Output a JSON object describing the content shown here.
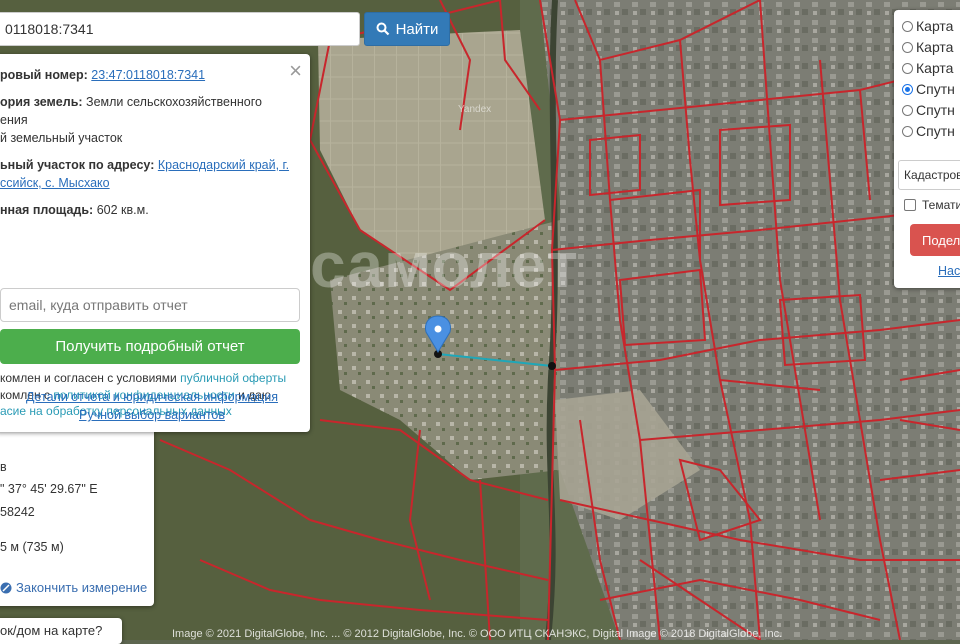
{
  "search": {
    "value": "0118018:7341",
    "button_label": "Найти"
  },
  "info": {
    "cadastral_label": "ровый номер:",
    "cadastral_number": "23:47:0118018:7341",
    "category_label": "ория земель:",
    "category_value": "Земли сельскохозяйственного",
    "category_value_cont": "ения",
    "type_value": "й земельный участок",
    "address_label": "ьный участок по адресу:",
    "address_value_line1": "Краснодарский край, г.",
    "address_value_line2": "ссийск, с. Мысхако",
    "area_label": "нная площадь:",
    "area_value": "602 кв.м.",
    "email_placeholder": "email, куда отправить отчет",
    "report_button": "Получить подробный отчет",
    "agree1_pre": "комлен и согласен с условиями ",
    "agree1_link": "публичной оферты",
    "agree2_pre": "комлен с ",
    "agree2_link": "политикой конфиденциальности",
    "agree2_post": " и даю",
    "agree3_link": "асие на обработку персональных данных",
    "details_link": "Детали отчета и юридическая информация",
    "manual_link": "Ручной выбор вариантов"
  },
  "measure": {
    "partial_header": "...",
    "line1": "в",
    "line2": "\" 37° 45' 29.67\" E",
    "line3": "58242",
    "line4": "5 м (735 м)",
    "finish_label": "Закончить измерение"
  },
  "bottom_question": "ок/дом на карте?",
  "layers": {
    "options": [
      {
        "label": "Карта",
        "selected": false
      },
      {
        "label": "Карта",
        "selected": false
      },
      {
        "label": "Карта",
        "selected": false
      },
      {
        "label": "Спутн",
        "selected": true
      },
      {
        "label": "Спутн",
        "selected": false
      },
      {
        "label": "Спутн",
        "selected": false
      }
    ],
    "select_value": "Кадастров",
    "checkbox_label": "Темати",
    "share_button": "Подел",
    "settings_link": "Нас"
  },
  "watermark": "самолет",
  "map_label": "Yandex",
  "copyright": "Image © 2021 DigitalGlobe, Inc. ... © 2012 DigitalGlobe, Inc. © ООО ИТЦ СКАНЭКС, Digital Image © 2018 DigitalGlobe, Inc.",
  "colors": {
    "parcel_lines": "#c8262c",
    "accent": "#337ab7",
    "report_button": "#4cae4c",
    "share_button": "#d9534f"
  }
}
